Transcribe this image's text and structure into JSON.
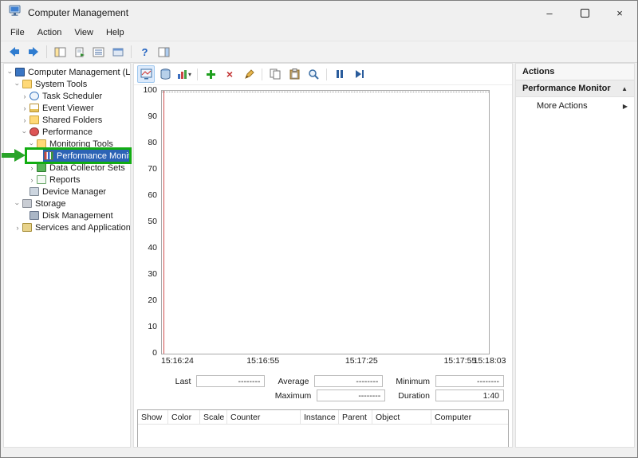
{
  "window": {
    "title": "Computer Management"
  },
  "icons": {
    "chevron": "›",
    "caret_up": "▲",
    "caret_right": "▶",
    "dropdown": "▾",
    "close": "×",
    "minimize": "–",
    "delete_x": "×",
    "help": "?"
  },
  "menu": {
    "items": [
      "File",
      "Action",
      "View",
      "Help"
    ]
  },
  "tree": {
    "items": [
      {
        "label": "Computer Management (Local)"
      },
      {
        "label": "System Tools"
      },
      {
        "label": "Task Scheduler"
      },
      {
        "label": "Event Viewer"
      },
      {
        "label": "Shared Folders"
      },
      {
        "label": "Performance"
      },
      {
        "label": "Monitoring Tools"
      },
      {
        "label": "Performance Monitor"
      },
      {
        "label": "Data Collector Sets"
      },
      {
        "label": "Reports"
      },
      {
        "label": "Device Manager"
      },
      {
        "label": "Storage"
      },
      {
        "label": "Disk Management"
      },
      {
        "label": "Services and Applications"
      }
    ]
  },
  "graph": {
    "y_labels": [
      "100",
      "90",
      "80",
      "70",
      "60",
      "50",
      "40",
      "30",
      "20",
      "10",
      "0"
    ],
    "x_labels": [
      "15:16:24",
      "15:16:55",
      "15:17:25",
      "15:17:55",
      "15:18:03"
    ]
  },
  "stats": {
    "last_label": "Last",
    "average_label": "Average",
    "minimum_label": "Minimum",
    "maximum_label": "Maximum",
    "duration_label": "Duration",
    "last": "--------",
    "average": "--------",
    "minimum": "--------",
    "maximum": "--------",
    "duration": "1:40"
  },
  "table": {
    "headers": [
      "Show",
      "Color",
      "Scale",
      "Counter",
      "Instance",
      "Parent",
      "Object",
      "Computer"
    ]
  },
  "actions": {
    "title": "Actions",
    "section": "Performance Monitor",
    "more": "More Actions"
  }
}
